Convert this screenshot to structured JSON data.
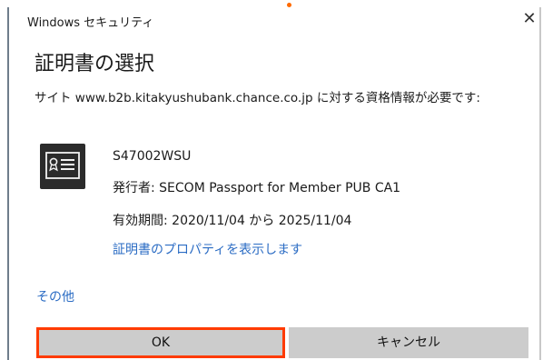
{
  "window": {
    "title": "Windows セキュリティ",
    "close_glyph": "✕",
    "close_icon": "close-icon"
  },
  "dialog": {
    "heading": "証明書の選択",
    "description": "サイト www.b2b.kitakyushubank.chance.co.jp に対する資格情報が必要です:"
  },
  "certificate": {
    "icon": "certificate-card-icon",
    "name": "S47002WSU",
    "issuer": "発行者: SECOM Passport for Member PUB CA1",
    "validity": "有効期間: 2020/11/04 から 2025/11/04",
    "properties_link": "証明書のプロパティを表示します"
  },
  "more_link": "その他",
  "buttons": {
    "ok": "OK",
    "cancel": "キャンセル"
  },
  "colors": {
    "link": "#2b6cc4",
    "highlight": "#ff3b00",
    "button_bg": "#cccccc",
    "top_dot": "#ff6a00"
  }
}
